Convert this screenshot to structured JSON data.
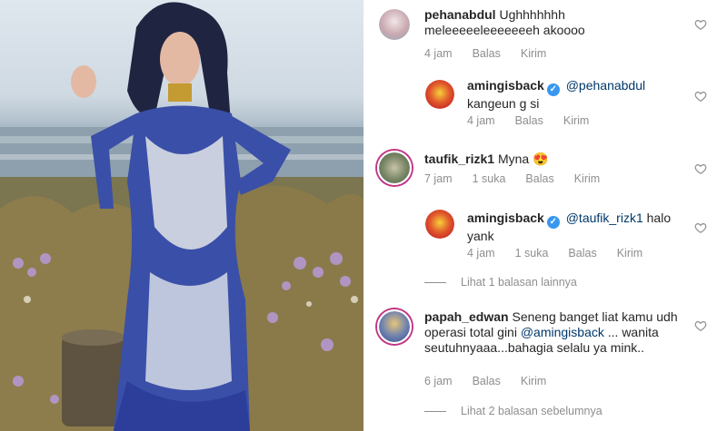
{
  "comments": [
    {
      "username": "pehanabdul",
      "verified": false,
      "text": "Ughhhhhhh meleeeeeleeeeeeeh akoooo",
      "mention": "",
      "time": "4 jam",
      "likes": "",
      "reply": "Balas",
      "send": "Kirim",
      "reply_item": false,
      "avatar_color": "#c9a9b0"
    },
    {
      "username": "amingisback",
      "verified": true,
      "mention": "@pehanabdul",
      "text": "kangeun g si",
      "time": "4 jam",
      "likes": "",
      "reply": "Balas",
      "send": "Kirim",
      "reply_item": true,
      "avatar_color": "#d8322a"
    },
    {
      "username": "taufik_rizk1",
      "verified": false,
      "text": "Myna",
      "emoji": "😍",
      "time": "7 jam",
      "likes": "1 suka",
      "reply": "Balas",
      "send": "Kirim",
      "reply_item": false,
      "avatar_color": "#7d8b6a"
    },
    {
      "username": "amingisback",
      "verified": true,
      "mention": "@taufik_rizk1",
      "text": "halo yank",
      "time": "4 jam",
      "likes": "1 suka",
      "reply": "Balas",
      "send": "Kirim",
      "reply_item": true,
      "avatar_color": "#d8322a"
    },
    {
      "username": "papah_edwan",
      "verified": false,
      "text_before": "Seneng banget liat kamu udh operasi total gini",
      "mention": "@amingisback",
      "text_after": "... wanita seutuhnyaaa...bahagia selalu ya mink..",
      "time": "6 jam",
      "likes": "",
      "reply": "Balas",
      "send": "Kirim",
      "reply_item": false,
      "avatar_color": "#4a6fa8"
    }
  ],
  "view_more_1": "Lihat 1 balasan lainnya",
  "view_more_2": "Lihat 2 balasan sebelumnya",
  "colors": {
    "mention": "#00376b",
    "meta": "#8e8e8e",
    "verified": "#3897f0",
    "story_ring": "#c13584"
  }
}
